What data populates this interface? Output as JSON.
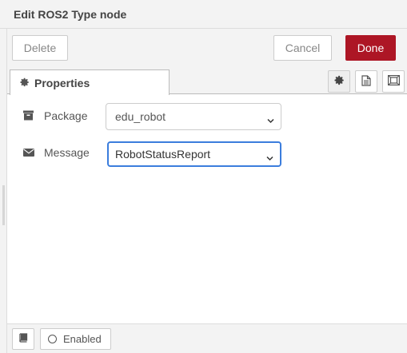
{
  "dialog": {
    "title": "Edit ROS2 Type node"
  },
  "toolbar": {
    "delete_label": "Delete",
    "cancel_label": "Cancel",
    "done_label": "Done"
  },
  "tabs": {
    "properties_label": "Properties",
    "icon_buttons": [
      "gear-icon",
      "description-icon",
      "appearance-icon"
    ]
  },
  "form": {
    "package": {
      "label": "Package",
      "icon": "archive-icon",
      "value": "edu_robot"
    },
    "message": {
      "label": "Message",
      "icon": "envelope-icon",
      "value": "RobotStatusReport"
    }
  },
  "footer": {
    "enabled_label": "Enabled",
    "book_icon": "book-icon"
  },
  "colors": {
    "done_button": "#ad1625",
    "focus_border": "#3b7ddd",
    "panel_bg": "#f3f3f3"
  }
}
